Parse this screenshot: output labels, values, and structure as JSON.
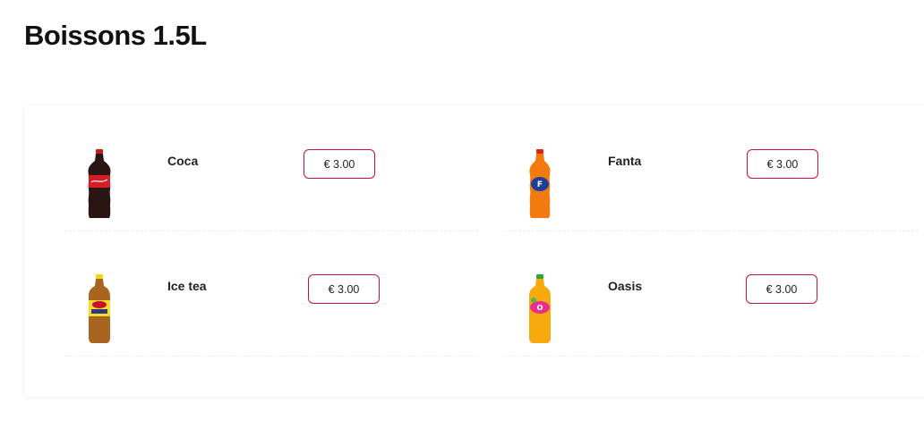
{
  "section": {
    "title": "Boissons 1.5L"
  },
  "products": [
    {
      "name": "Coca",
      "price": "€ 3.00",
      "icon": "coca-bottle-icon"
    },
    {
      "name": "Fanta",
      "price": "€ 3.00",
      "icon": "fanta-bottle-icon"
    },
    {
      "name": "Ice tea",
      "price": "€ 3.00",
      "icon": "ice-tea-bottle-icon"
    },
    {
      "name": "Oasis",
      "price": "€ 3.00",
      "icon": "oasis-bottle-icon"
    }
  ],
  "colors": {
    "accent": "#c8103c",
    "text": "#111111"
  }
}
